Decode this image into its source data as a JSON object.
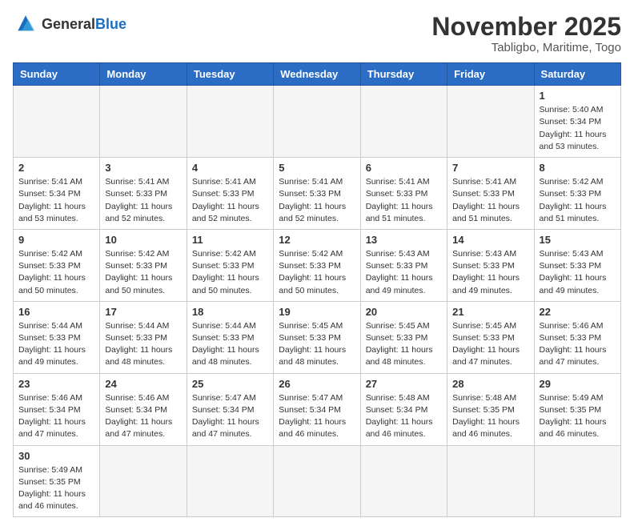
{
  "header": {
    "logo_general": "General",
    "logo_blue": "Blue",
    "month_title": "November 2025",
    "location": "Tabligbo, Maritime, Togo"
  },
  "days_of_week": [
    "Sunday",
    "Monday",
    "Tuesday",
    "Wednesday",
    "Thursday",
    "Friday",
    "Saturday"
  ],
  "weeks": [
    [
      {
        "day": "",
        "info": ""
      },
      {
        "day": "",
        "info": ""
      },
      {
        "day": "",
        "info": ""
      },
      {
        "day": "",
        "info": ""
      },
      {
        "day": "",
        "info": ""
      },
      {
        "day": "",
        "info": ""
      },
      {
        "day": "1",
        "info": "Sunrise: 5:40 AM\nSunset: 5:34 PM\nDaylight: 11 hours\nand 53 minutes."
      }
    ],
    [
      {
        "day": "2",
        "info": "Sunrise: 5:41 AM\nSunset: 5:34 PM\nDaylight: 11 hours\nand 53 minutes."
      },
      {
        "day": "3",
        "info": "Sunrise: 5:41 AM\nSunset: 5:33 PM\nDaylight: 11 hours\nand 52 minutes."
      },
      {
        "day": "4",
        "info": "Sunrise: 5:41 AM\nSunset: 5:33 PM\nDaylight: 11 hours\nand 52 minutes."
      },
      {
        "day": "5",
        "info": "Sunrise: 5:41 AM\nSunset: 5:33 PM\nDaylight: 11 hours\nand 52 minutes."
      },
      {
        "day": "6",
        "info": "Sunrise: 5:41 AM\nSunset: 5:33 PM\nDaylight: 11 hours\nand 51 minutes."
      },
      {
        "day": "7",
        "info": "Sunrise: 5:41 AM\nSunset: 5:33 PM\nDaylight: 11 hours\nand 51 minutes."
      },
      {
        "day": "8",
        "info": "Sunrise: 5:42 AM\nSunset: 5:33 PM\nDaylight: 11 hours\nand 51 minutes."
      }
    ],
    [
      {
        "day": "9",
        "info": "Sunrise: 5:42 AM\nSunset: 5:33 PM\nDaylight: 11 hours\nand 50 minutes."
      },
      {
        "day": "10",
        "info": "Sunrise: 5:42 AM\nSunset: 5:33 PM\nDaylight: 11 hours\nand 50 minutes."
      },
      {
        "day": "11",
        "info": "Sunrise: 5:42 AM\nSunset: 5:33 PM\nDaylight: 11 hours\nand 50 minutes."
      },
      {
        "day": "12",
        "info": "Sunrise: 5:42 AM\nSunset: 5:33 PM\nDaylight: 11 hours\nand 50 minutes."
      },
      {
        "day": "13",
        "info": "Sunrise: 5:43 AM\nSunset: 5:33 PM\nDaylight: 11 hours\nand 49 minutes."
      },
      {
        "day": "14",
        "info": "Sunrise: 5:43 AM\nSunset: 5:33 PM\nDaylight: 11 hours\nand 49 minutes."
      },
      {
        "day": "15",
        "info": "Sunrise: 5:43 AM\nSunset: 5:33 PM\nDaylight: 11 hours\nand 49 minutes."
      }
    ],
    [
      {
        "day": "16",
        "info": "Sunrise: 5:44 AM\nSunset: 5:33 PM\nDaylight: 11 hours\nand 49 minutes."
      },
      {
        "day": "17",
        "info": "Sunrise: 5:44 AM\nSunset: 5:33 PM\nDaylight: 11 hours\nand 48 minutes."
      },
      {
        "day": "18",
        "info": "Sunrise: 5:44 AM\nSunset: 5:33 PM\nDaylight: 11 hours\nand 48 minutes."
      },
      {
        "day": "19",
        "info": "Sunrise: 5:45 AM\nSunset: 5:33 PM\nDaylight: 11 hours\nand 48 minutes."
      },
      {
        "day": "20",
        "info": "Sunrise: 5:45 AM\nSunset: 5:33 PM\nDaylight: 11 hours\nand 48 minutes."
      },
      {
        "day": "21",
        "info": "Sunrise: 5:45 AM\nSunset: 5:33 PM\nDaylight: 11 hours\nand 47 minutes."
      },
      {
        "day": "22",
        "info": "Sunrise: 5:46 AM\nSunset: 5:33 PM\nDaylight: 11 hours\nand 47 minutes."
      }
    ],
    [
      {
        "day": "23",
        "info": "Sunrise: 5:46 AM\nSunset: 5:34 PM\nDaylight: 11 hours\nand 47 minutes."
      },
      {
        "day": "24",
        "info": "Sunrise: 5:46 AM\nSunset: 5:34 PM\nDaylight: 11 hours\nand 47 minutes."
      },
      {
        "day": "25",
        "info": "Sunrise: 5:47 AM\nSunset: 5:34 PM\nDaylight: 11 hours\nand 47 minutes."
      },
      {
        "day": "26",
        "info": "Sunrise: 5:47 AM\nSunset: 5:34 PM\nDaylight: 11 hours\nand 46 minutes."
      },
      {
        "day": "27",
        "info": "Sunrise: 5:48 AM\nSunset: 5:34 PM\nDaylight: 11 hours\nand 46 minutes."
      },
      {
        "day": "28",
        "info": "Sunrise: 5:48 AM\nSunset: 5:35 PM\nDaylight: 11 hours\nand 46 minutes."
      },
      {
        "day": "29",
        "info": "Sunrise: 5:49 AM\nSunset: 5:35 PM\nDaylight: 11 hours\nand 46 minutes."
      }
    ],
    [
      {
        "day": "30",
        "info": "Sunrise: 5:49 AM\nSunset: 5:35 PM\nDaylight: 11 hours\nand 46 minutes."
      },
      {
        "day": "",
        "info": ""
      },
      {
        "day": "",
        "info": ""
      },
      {
        "day": "",
        "info": ""
      },
      {
        "day": "",
        "info": ""
      },
      {
        "day": "",
        "info": ""
      },
      {
        "day": "",
        "info": ""
      }
    ]
  ]
}
